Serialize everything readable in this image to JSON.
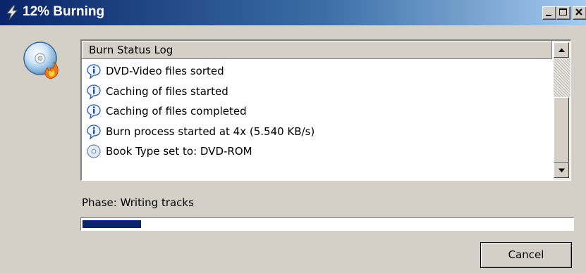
{
  "window": {
    "title": "12% Burning",
    "title_icon": "burn-lightning-icon",
    "controls": {
      "minimize_icon": "minimize-icon",
      "maximize_icon": "maximize-icon",
      "close_icon": "close-icon"
    },
    "colors": {
      "titlebar_start": "#0a246a",
      "titlebar_end": "#a6caf0",
      "face": "#d4d0c8"
    }
  },
  "app_icon": "disc-burning-icon",
  "log": {
    "header": "Burn Status Log",
    "entries": [
      {
        "icon": "info-icon",
        "text": "DVD-Video files sorted"
      },
      {
        "icon": "info-icon",
        "text": "Caching of files started"
      },
      {
        "icon": "info-icon",
        "text": "Caching of files completed"
      },
      {
        "icon": "info-icon",
        "text": "Burn process started at 4x (5.540 KB/s)"
      },
      {
        "icon": "disc-icon",
        "text": "Book Type set to: DVD-ROM"
      }
    ]
  },
  "phase": {
    "text": "Phase: Writing tracks"
  },
  "progress": {
    "value_percent": 12,
    "fill_color": "#0a246a"
  },
  "buttons": {
    "cancel_label": "Cancel"
  }
}
